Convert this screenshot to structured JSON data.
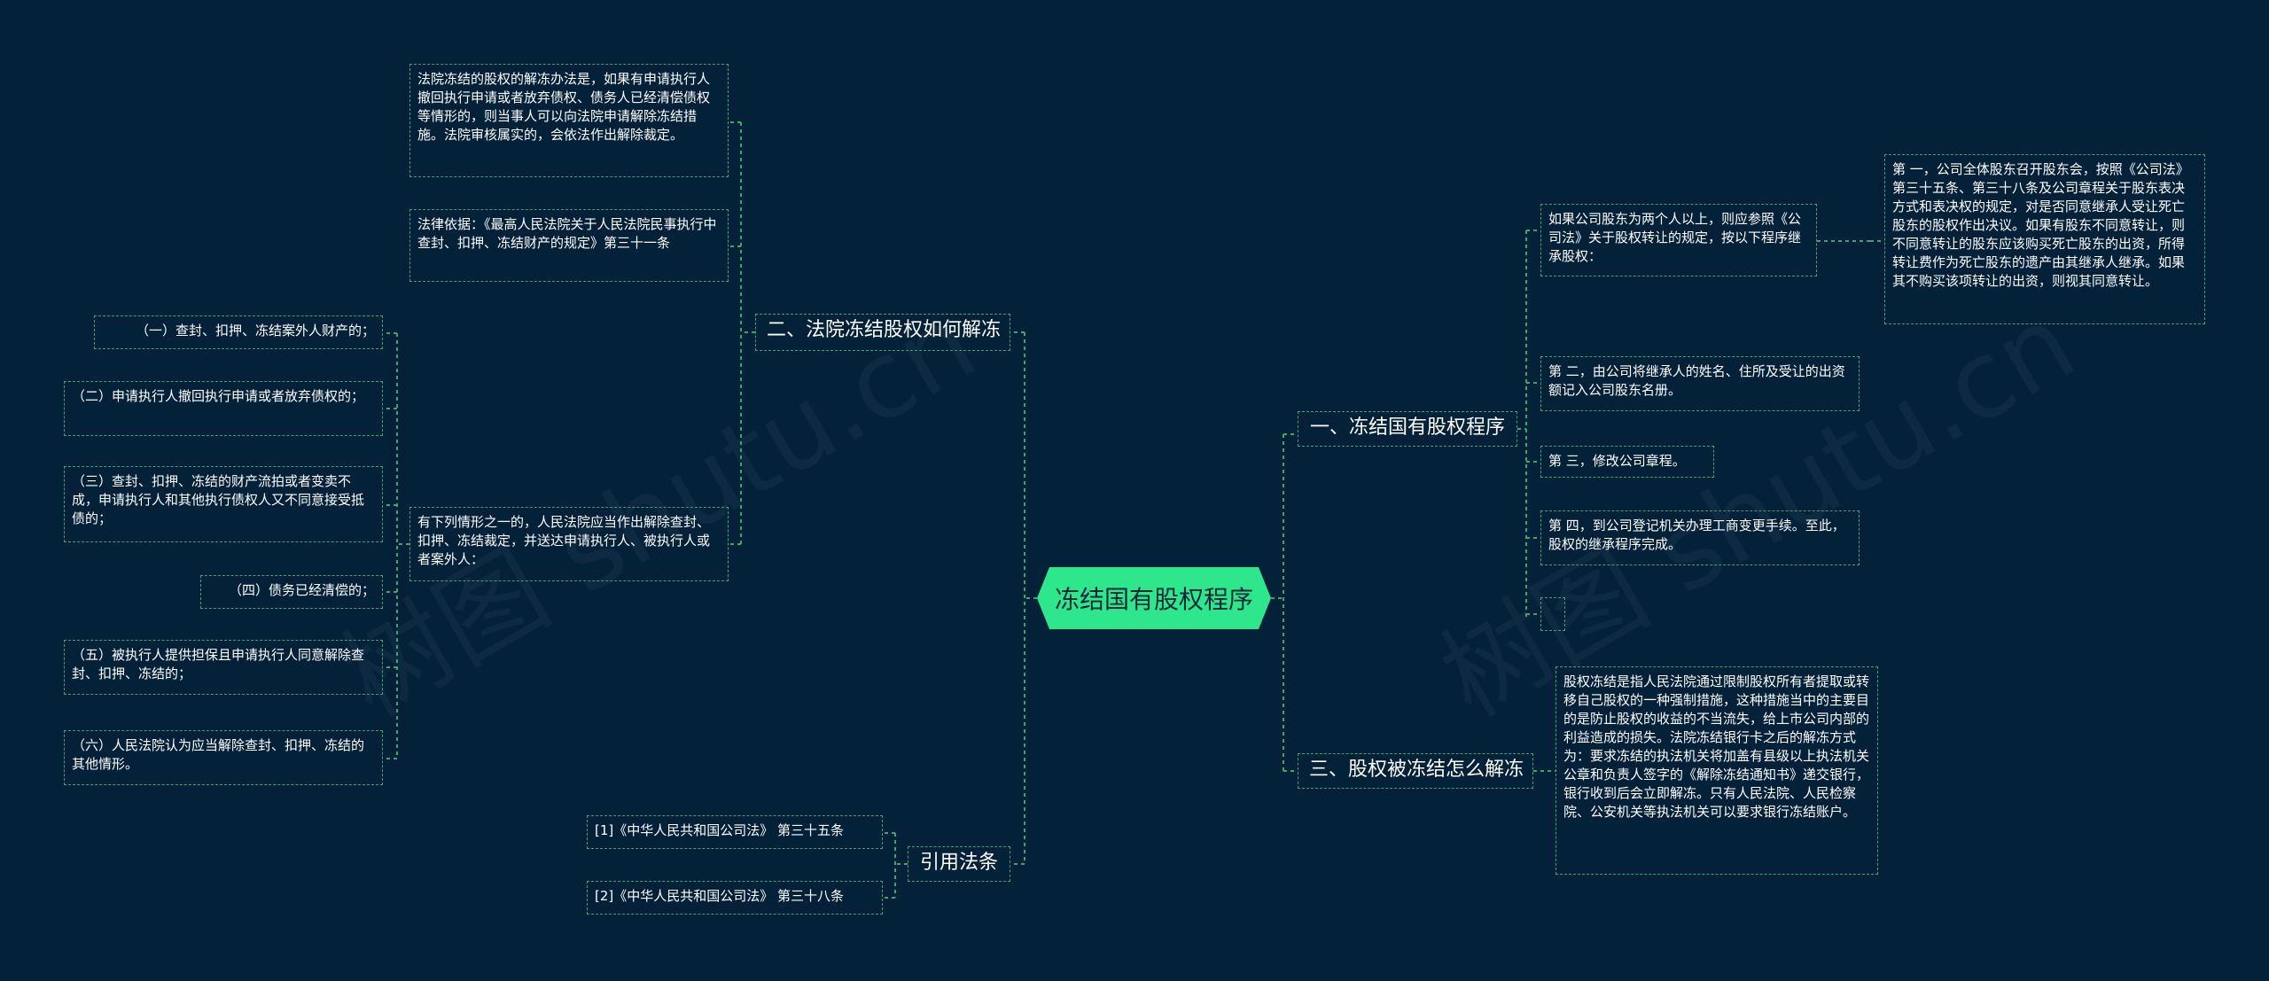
{
  "root": {
    "label": "冻结国有股权程序"
  },
  "watermarks": [
    "树图 shutu.cn",
    "树图 shutu.cn"
  ],
  "branch1": {
    "label": "一、冻结国有股权程序",
    "item1": "如果公司股东为两个人以上，则应参照《公司法》关于股权转让的规定，按以下程序继承股权：",
    "item1_detail": "第 一，公司全体股东召开股东会，按照《公司法》第三十五条、第三十八条及公司章程关于股东表决方式和表决权的规定，对是否同意继承人受让死亡股东的股权作出决议。如果有股东不同意转让，则不同意转让的股东应该购买死亡股东的出资，所得转让费作为死亡股东的遗产由其继承人继承。如果其不购买该项转让的出资，则视其同意转让。",
    "item2": "第 二，由公司将继承人的姓名、住所及受让的出资额记入公司股东名册。",
    "item3": "第 三，修改公司章程。",
    "item4": "第 四，到公司登记机关办理工商变更手续。至此，股权的继承程序完成。"
  },
  "branch2": {
    "label": "二、法院冻结股权如何解冻",
    "n1": "法院冻结的股权的解冻办法是，如果有申请执行人撤回执行申请或者放弃债权、债务人已经清偿债权等情形的，则当事人可以向法院申请解除冻结措施。法院审核属实的，会依法作出解除裁定。",
    "n2": "法律依据：《最高人民法院关于人民法院民事执行中查封、扣押、冻结财产的规定》第三十一条",
    "n3": "有下列情形之一的，人民法院应当作出解除查封、扣押、冻结裁定，并送达申请执行人、被执行人或者案外人：",
    "subs": [
      "（一）查封、扣押、冻结案外人财产的；",
      "（二）申请执行人撤回执行申请或者放弃债权的；",
      "（三）查封、扣押、冻结的财产流拍或者变卖不成，申请执行人和其他执行债权人又不同意接受抵债的；",
      "（四）债务已经清偿的；",
      "（五）被执行人提供担保且申请执行人同意解除查封、扣押、冻结的；",
      "（六）人民法院认为应当解除查封、扣押、冻结的其他情形。"
    ]
  },
  "branch3": {
    "label": "三、股权被冻结怎么解冻",
    "detail": "股权冻结是指人民法院通过限制股权所有者提取或转移自己股权的一种强制措施，这种措施当中的主要目的是防止股权的收益的不当流失，给上市公司内部的利益造成的损失。法院冻结银行卡之后的解冻方式为：要求冻结的执法机关将加盖有县级以上执法机关公章和负责人签字的《解除冻结通知书》递交银行，银行收到后会立即解冻。只有人民法院、人民检察院、公安机关等执法机关可以要求银行冻结账户。"
  },
  "branch4": {
    "label": "引用法条",
    "refs": [
      "[1]《中华人民共和国公司法》 第三十五条",
      "[2]《中华人民共和国公司法》 第三十八条"
    ]
  },
  "colors": {
    "background": "#04213a",
    "line": "#3ea66b",
    "root_fill": "#2ee68c",
    "text": "#ffffff"
  }
}
